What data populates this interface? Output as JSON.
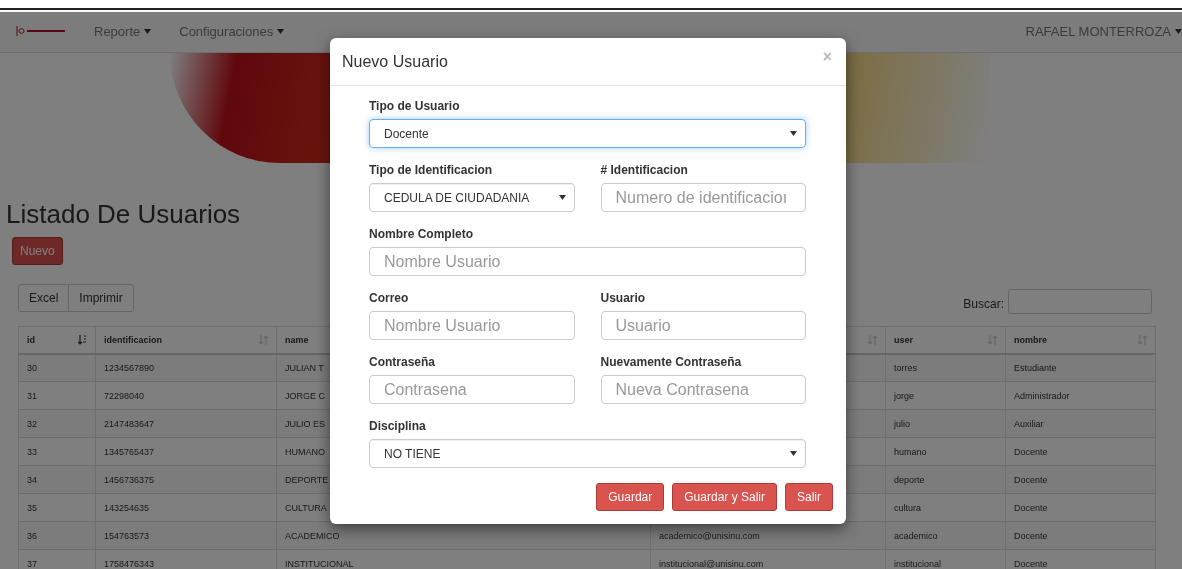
{
  "navbar": {
    "menus": [
      {
        "label": "Reporte"
      },
      {
        "label": "Configuraciones"
      }
    ],
    "user": "RAFAEL MONTERROZA"
  },
  "page": {
    "title": "Listado De Usuarios",
    "new_button": "Nuevo",
    "export_buttons": [
      "Excel",
      "Imprimir"
    ],
    "search_label": "Buscar:"
  },
  "table": {
    "columns": [
      {
        "label": "id",
        "sorted": true
      },
      {
        "label": "identificacion",
        "sorted": false
      },
      {
        "label": "name"
      },
      {
        "sorted": false
      },
      {
        "label": "user",
        "sorted": false
      },
      {
        "label": "nombre",
        "sorted": false
      }
    ],
    "rows": [
      [
        "30",
        "1234567890",
        "JULIAN T",
        null,
        "torres",
        "Estudiante"
      ],
      [
        "31",
        "72298040",
        "JORGE C",
        null,
        "jorge",
        "Administrador"
      ],
      [
        "32",
        "2147483647",
        "JULIO ES",
        null,
        "julio",
        "Auxiliar"
      ],
      [
        "33",
        "1345765437",
        "HUMANO",
        null,
        "humano",
        "Docente"
      ],
      [
        "34",
        "1456736375",
        "DEPORTE",
        null,
        "deporte",
        "Docente"
      ],
      [
        "35",
        "143254635",
        "CULTURA",
        null,
        "cultura",
        "Docente"
      ],
      [
        "36",
        "154763573",
        "ACADEMICO",
        "academico@unisinu.com",
        "academico",
        "Docente"
      ],
      [
        "37",
        "1758476343",
        "INSTITUCIONAL",
        "institucional@unisinu.com",
        "institucional",
        "Docente"
      ]
    ]
  },
  "modal": {
    "title": "Nuevo Usuario",
    "close": "×",
    "form_rows": [
      [
        {
          "kind": "select",
          "label": "Tipo de Usuario",
          "value": "Docente",
          "focused": true
        }
      ],
      [
        {
          "kind": "select",
          "label": "Tipo de Identificacion",
          "value": "CEDULA DE CIUDADANIA",
          "focused": false
        },
        {
          "kind": "input",
          "label": "# Identificacion",
          "placeholder": "Numero de identificacioı",
          "focused": false
        }
      ],
      [
        {
          "kind": "input",
          "label": "Nombre Completo",
          "placeholder": "Nombre Usuario",
          "focused": false
        }
      ],
      [
        {
          "kind": "input",
          "label": "Correo",
          "placeholder": "Nombre Usuario",
          "focused": false
        },
        {
          "kind": "input",
          "label": "Usuario",
          "placeholder": "Usuario",
          "focused": false
        }
      ],
      [
        {
          "kind": "input",
          "label": "Contraseña",
          "placeholder": "Contrasena",
          "focused": false
        },
        {
          "kind": "input",
          "label": "Nuevamente Contraseña",
          "placeholder": "Nueva Contrasena",
          "focused": false
        }
      ],
      [
        {
          "kind": "select",
          "label": "Disciplina",
          "value": "NO TIENE",
          "focused": false
        }
      ]
    ],
    "buttons": [
      "Guardar",
      "Guardar y Salir",
      "Salir"
    ]
  }
}
